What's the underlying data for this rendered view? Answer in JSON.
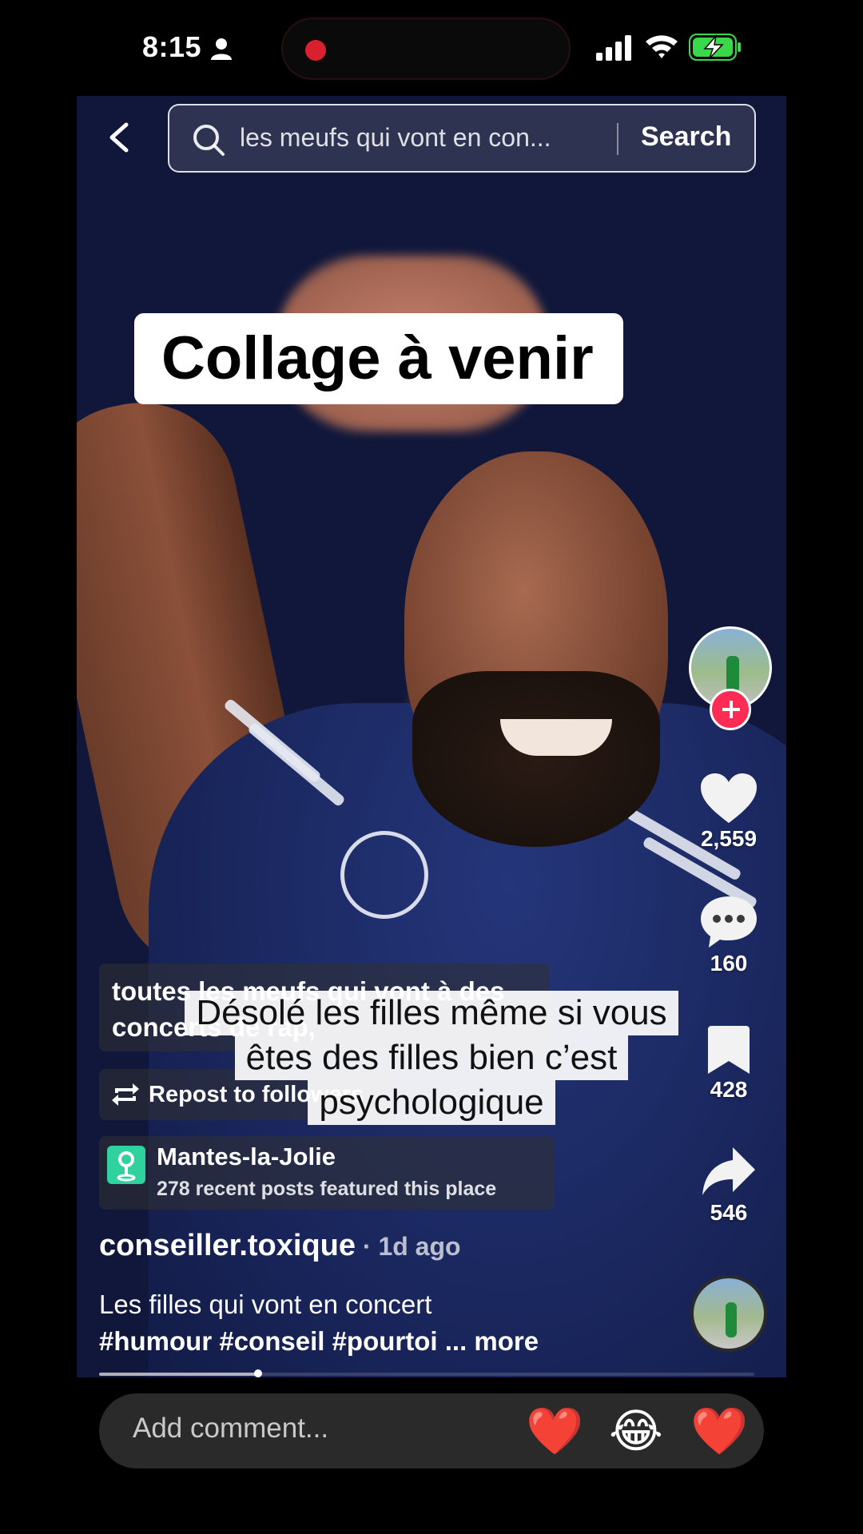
{
  "status_bar": {
    "time": "8:15"
  },
  "search": {
    "query": "les meufs qui vont en con...",
    "button_label": "Search"
  },
  "video": {
    "overlay_title": "Collage à venir",
    "subtitle_lines": [
      "Désolé les filles même si vous",
      "êtes des filles bien c’est",
      "psychologique"
    ]
  },
  "info": {
    "description_card": "toutes les meufs qui vont à des concerts de rap,",
    "repost_label": "Repost to followers",
    "place": {
      "name": "Mantes-la-Jolie",
      "sub": "278 recent posts featured this place"
    },
    "author": "conseiller.toxique",
    "posted": " · 1d ago",
    "caption": "Les filles qui vont en concert",
    "hashtags": "#humour #conseil #pourtoi",
    "more_label": "... more"
  },
  "rail": {
    "likes": "2,559",
    "comments": "160",
    "saves": "428",
    "shares": "546"
  },
  "comment_bar": {
    "placeholder": "Add comment...",
    "emojis": [
      "❤️",
      "😂",
      "❤️"
    ]
  },
  "colors": {
    "follow": "#fe2c55",
    "place_badge": "#2fd29d",
    "battery": "#3ad94a"
  }
}
